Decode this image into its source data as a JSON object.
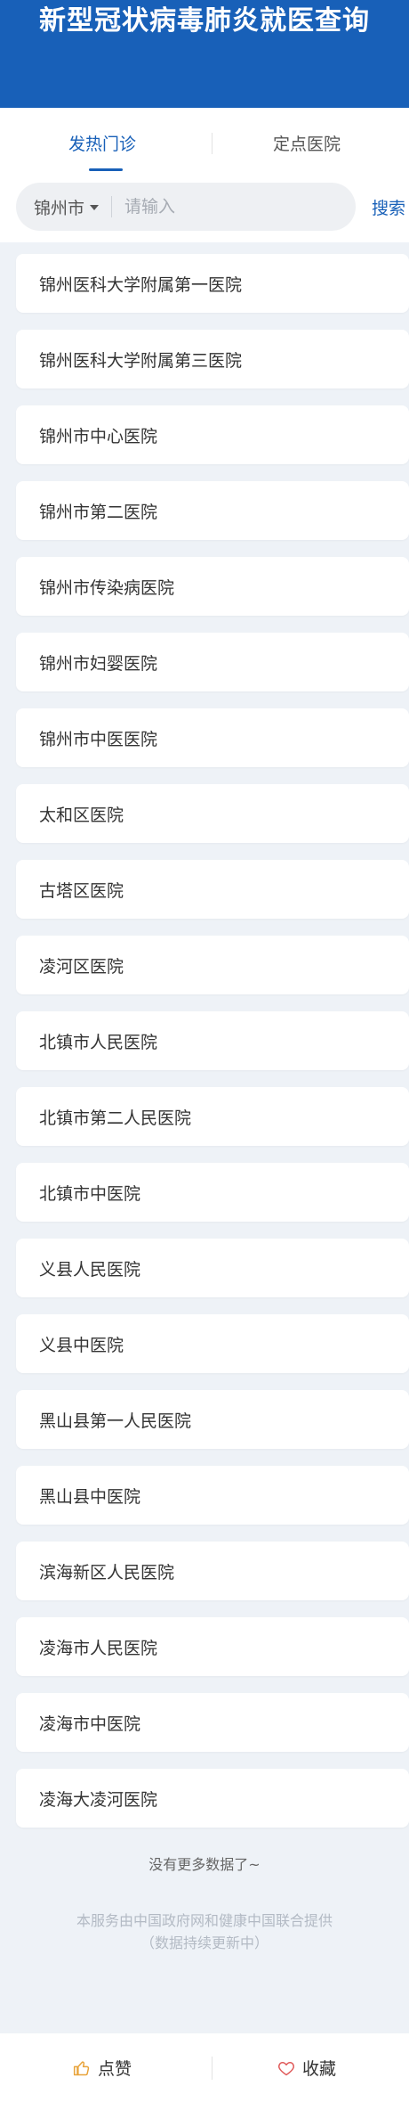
{
  "header": {
    "title": "新型冠状病毒肺炎就医查询"
  },
  "tabs": [
    {
      "label": "发热门诊",
      "active": true
    },
    {
      "label": "定点医院",
      "active": false
    }
  ],
  "search": {
    "city": "锦州市",
    "placeholder": "请输入",
    "value": "",
    "button_label": "搜索"
  },
  "hospitals": [
    "锦州医科大学附属第一医院",
    "锦州医科大学附属第三医院",
    "锦州市中心医院",
    "锦州市第二医院",
    "锦州市传染病医院",
    "锦州市妇婴医院",
    "锦州市中医医院",
    "太和区医院",
    "古塔区医院",
    "凌河区医院",
    "北镇市人民医院",
    "北镇市第二人民医院",
    "北镇市中医院",
    "义县人民医院",
    "义县中医院",
    "黑山县第一人民医院",
    "黑山县中医院",
    "滨海新区人民医院",
    "凌海市人民医院",
    "凌海市中医院",
    "凌海大凌河医院"
  ],
  "list_end_text": "没有更多数据了~",
  "footer_note": {
    "line1": "本服务由中国政府网和健康中国联合提供",
    "line2": "（数据持续更新中）"
  },
  "bottom_bar": {
    "like_label": "点赞",
    "like_icon": "thumbs-up-icon",
    "favorite_label": "收藏",
    "favorite_icon": "heart-icon"
  },
  "colors": {
    "brand_blue": "#1860b8",
    "page_bg": "#eef2f7",
    "like_icon": "#e8a33a",
    "heart_icon": "#e05a5a"
  }
}
